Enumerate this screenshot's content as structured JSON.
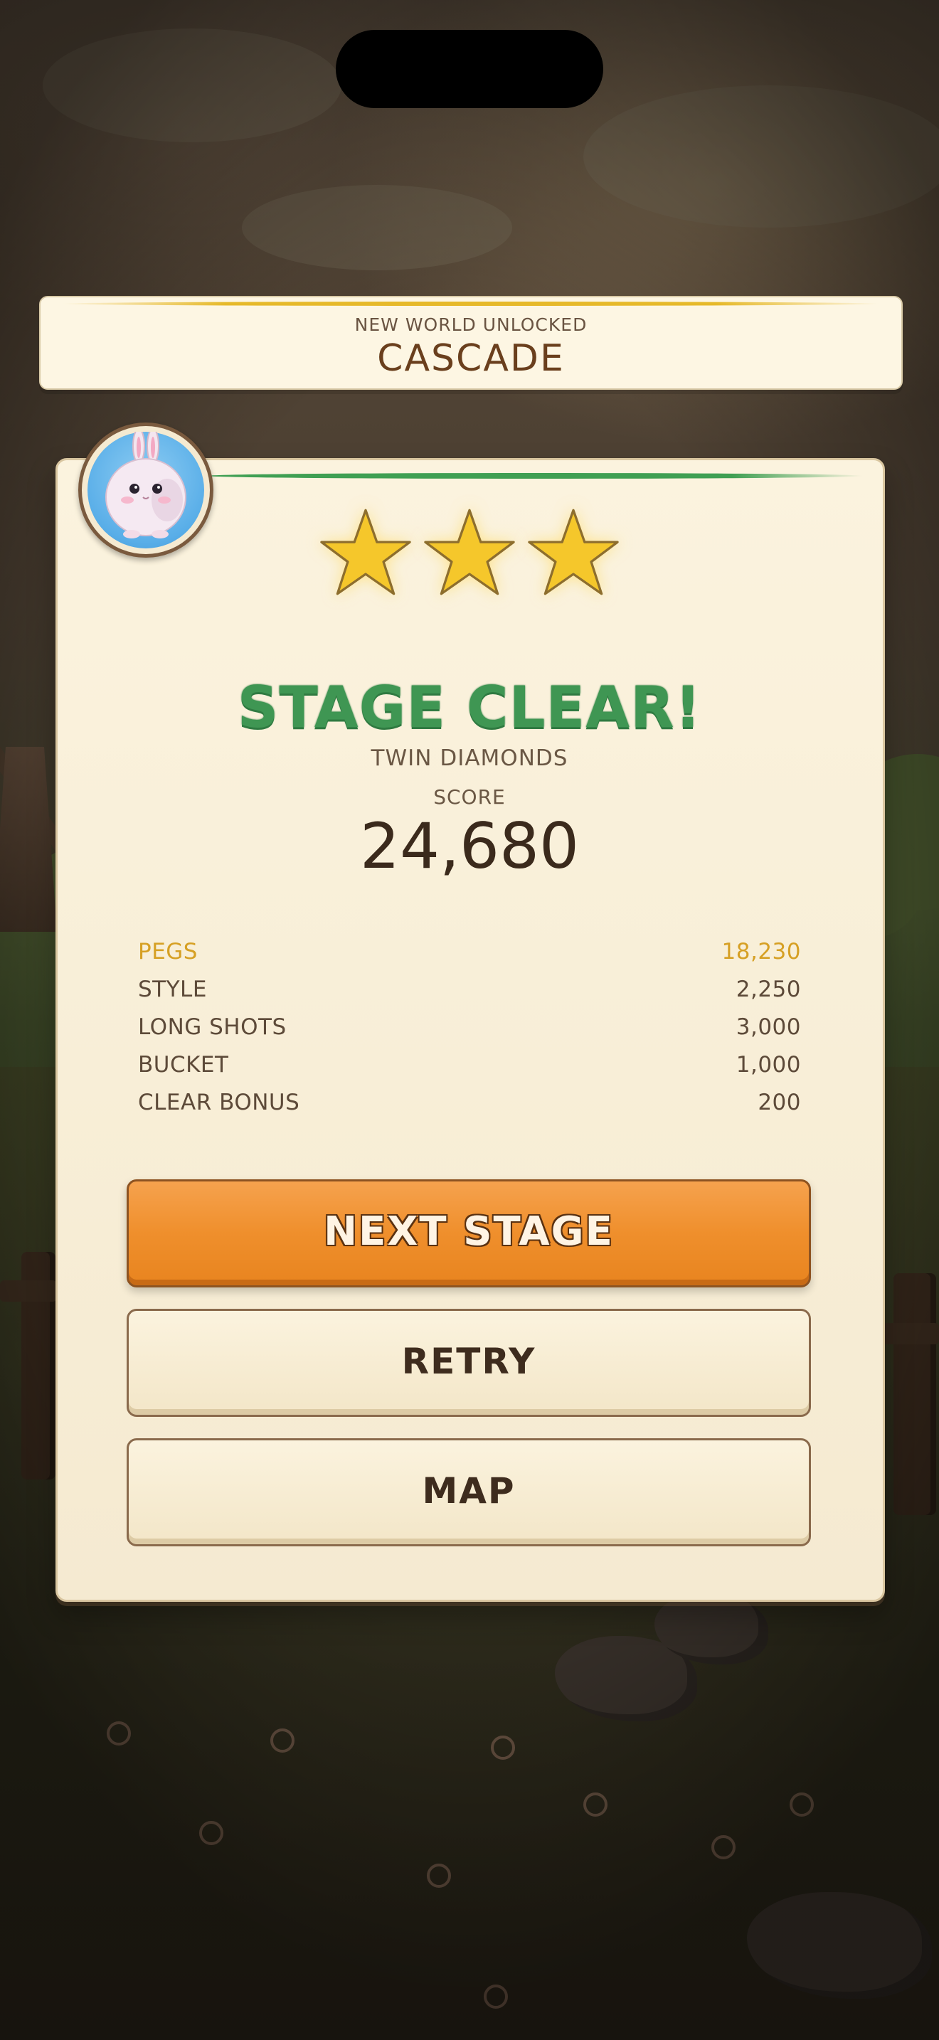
{
  "banner": {
    "subtitle": "NEW WORLD UNLOCKED",
    "world_name": "CASCADE"
  },
  "result": {
    "stars_earned": 3,
    "stars_total": 3,
    "heading": "STAGE CLEAR!",
    "stage_name": "TWIN DIAMONDS",
    "score_label": "SCORE",
    "score_value": "24,680"
  },
  "breakdown": [
    {
      "label": "PEGS",
      "value": "18,230",
      "highlight": true
    },
    {
      "label": "STYLE",
      "value": "2,250",
      "highlight": false
    },
    {
      "label": "LONG SHOTS",
      "value": "3,000",
      "highlight": false
    },
    {
      "label": "BUCKET",
      "value": "1,000",
      "highlight": false
    },
    {
      "label": "CLEAR BONUS",
      "value": "200",
      "highlight": false
    }
  ],
  "buttons": {
    "next": "NEXT STAGE",
    "retry": "RETRY",
    "map": "MAP"
  },
  "icons": {
    "avatar": "bunny-avatar-icon",
    "star": "star-icon"
  },
  "colors": {
    "accent_green": "#3f9653",
    "primary_orange": "#ef8f2c",
    "highlight_gold": "#d6a024",
    "card_bg": "#fbf3de"
  }
}
